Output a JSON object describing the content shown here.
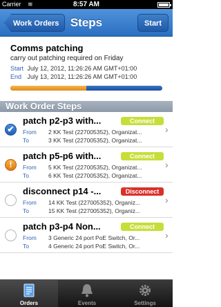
{
  "status_bar": {
    "carrier": "Carrier",
    "time": "8:57 AM"
  },
  "nav": {
    "back_label": "Work Orders",
    "title": "Steps",
    "start_label": "Start"
  },
  "header": {
    "title": "Comms patching",
    "subtitle": "carry out patching required on Friday",
    "start_key": "Start",
    "start_value": "July 12, 2012, 11:26:26 AM GMT+01:00",
    "end_key": "End",
    "end_value": "July 13, 2012, 11:26:26 AM GMT+01:00",
    "progress": 0.5
  },
  "section_title": "Work Order Steps",
  "steps": [
    {
      "state": "done",
      "state_glyph": "✔",
      "title": "patch p2-p3 with...",
      "action": "Connect",
      "action_type": "connect",
      "from": "2 KK Test (227005352), Organizat...",
      "to": "3 KK Test (227005352), Organizat..."
    },
    {
      "state": "warning",
      "state_glyph": "!",
      "title": "patch p5-p6 with...",
      "action": "Connect",
      "action_type": "connect",
      "from": "5 KK Test (227005352), Organizat...",
      "to": "6 KK Test (227005352), Organizat..."
    },
    {
      "state": "pending",
      "state_glyph": "",
      "title": "disconnect  p14 -...",
      "action": "Disconnect",
      "action_type": "disconnect",
      "from": "14 KK Test (227005352), Organiz...",
      "to": "15 KK Test (227005352), Organiz..."
    },
    {
      "state": "pending",
      "state_glyph": "",
      "title": "patch p3-p4 Non...",
      "action": "Connect",
      "action_type": "connect",
      "from": "3 Generic 24 port PoE Switch, Or...",
      "to": "4 Generic 24 port PoE Switch, Or..."
    }
  ],
  "labels": {
    "from": "From",
    "to": "To"
  },
  "tabs": [
    {
      "label": "Orders",
      "icon": "orders-icon",
      "active": true
    },
    {
      "label": "Events",
      "icon": "bell-icon",
      "active": false
    },
    {
      "label": "Settings",
      "icon": "gear-icon",
      "active": false
    }
  ],
  "colors": {
    "nav_blue": "#2a6fc2",
    "progress_orange": "#e1891a",
    "connect_green": "#c7de3a",
    "disconnect_red": "#d9302c"
  }
}
